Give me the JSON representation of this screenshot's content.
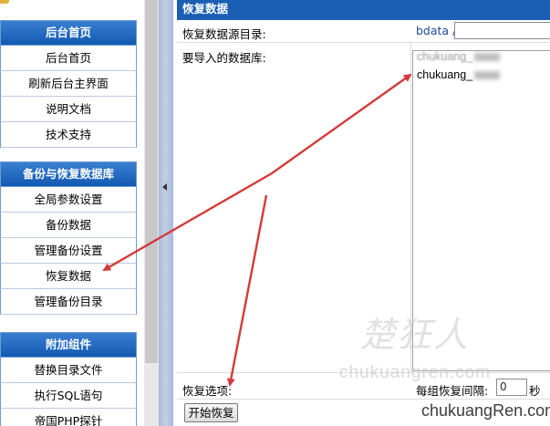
{
  "sidebar": {
    "groups": [
      {
        "title": "后台首页",
        "items": [
          "后台首页",
          "刷新后台主界面",
          "说明文档",
          "技术支持"
        ]
      },
      {
        "title": "备份与恢复数据库",
        "items": [
          "全局参数设置",
          "备份数据",
          "管理备份设置",
          "恢复数据",
          "管理备份目录"
        ]
      },
      {
        "title": "附加组件",
        "items": [
          "替换目录文件",
          "执行SQL语句",
          "帝国PHP探针"
        ]
      }
    ]
  },
  "main": {
    "title": "恢复数据",
    "source_dir_label": "恢复数据源目录:",
    "source_dir_prefix": "bdata /",
    "source_dir_value": "",
    "db_label": "要导入的数据库:",
    "databases": [
      "chukuang_",
      "chukuang_"
    ],
    "options_label": "恢复选项:",
    "interval_label": "每组恢复间隔:",
    "interval_value": "0",
    "interval_unit": "秒",
    "start_button": "开始恢复"
  },
  "watermark": {
    "calligraphy": "楚狂人",
    "url_faint": "chukuangren.com",
    "url": "chukuangRen.com"
  },
  "colors": {
    "header_blue": "#1a5fb4",
    "arrow_red": "#d43a3a",
    "splitter": "#b3c2df"
  },
  "icons": {
    "collapse_arrow": "triangle-left"
  }
}
